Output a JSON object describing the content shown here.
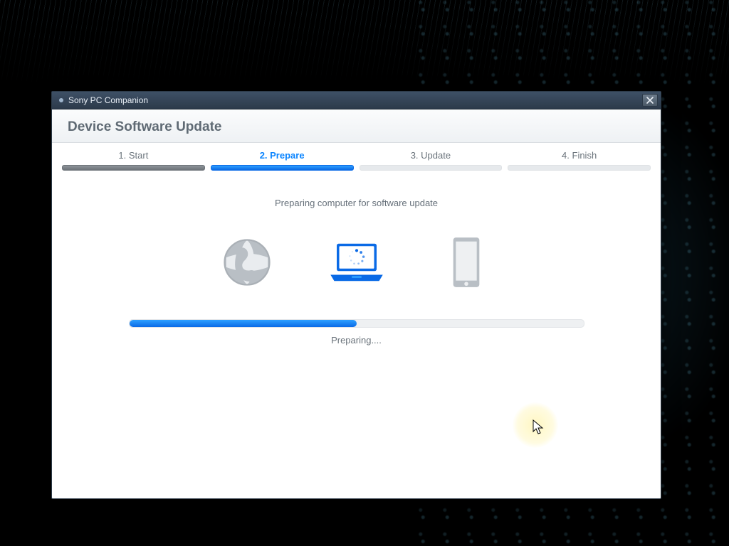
{
  "window": {
    "title": "Sony PC Companion"
  },
  "header": {
    "title": "Device Software Update"
  },
  "steps": [
    {
      "label": "1. Start",
      "state": "done"
    },
    {
      "label": "2. Prepare",
      "state": "active"
    },
    {
      "label": "3. Update",
      "state": "pending"
    },
    {
      "label": "4. Finish",
      "state": "pending"
    }
  ],
  "subtitle": "Preparing computer for software update",
  "icons": {
    "globe": "globe-icon",
    "laptop": "laptop-icon",
    "phone": "phone-icon"
  },
  "progress": {
    "percent": 50,
    "label": "Preparing...."
  },
  "colors": {
    "accent": "#0a84ff",
    "accent_dark": "#0a6ae6",
    "step_done": "#777d83",
    "text_muted": "#6a737b"
  }
}
